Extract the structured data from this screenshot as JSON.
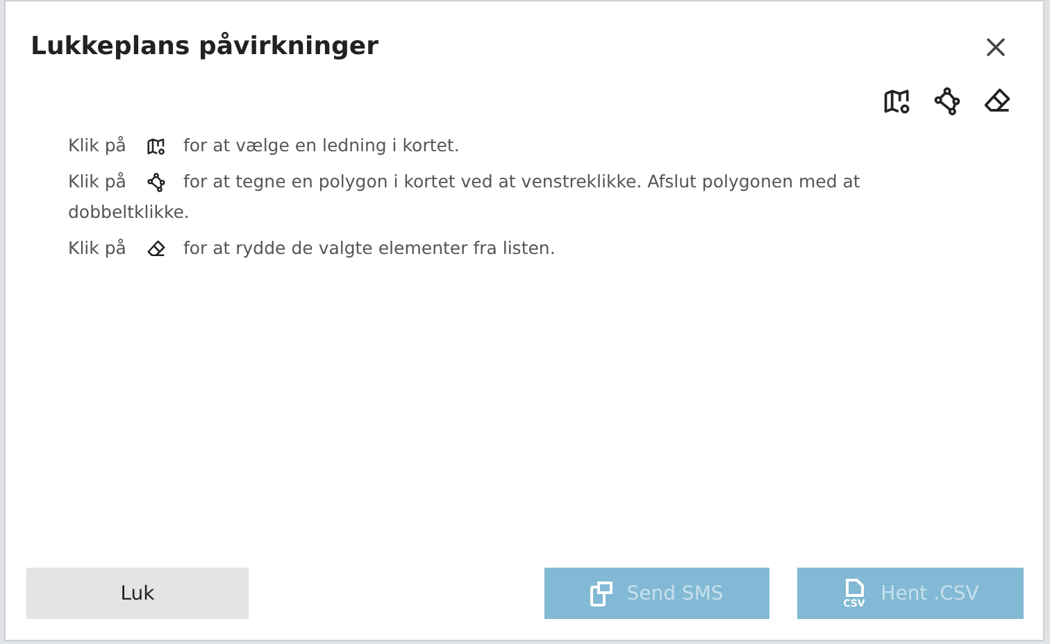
{
  "dialog": {
    "title": "Lukkeplans påvirkninger"
  },
  "tools": [
    {
      "kind": "map"
    },
    {
      "kind": "polygon"
    },
    {
      "kind": "eraser"
    }
  ],
  "instructions": [
    {
      "prefix": "Klik på",
      "kind": "map",
      "text": "for at vælge en ledning i kortet."
    },
    {
      "prefix": "Klik på",
      "kind": "polygon",
      "text": "for at tegne en polygon i kortet ved at venstreklikke. Afslut polygonen med at",
      "continuation": "dobbeltklikke."
    },
    {
      "prefix": "Klik på",
      "kind": "eraser",
      "text": "for at rydde de valgte elementer fra listen."
    }
  ],
  "buttons": [
    {
      "label": "Luk",
      "kind": "close",
      "disabled": false
    },
    {
      "label": "Send SMS",
      "kind": "sms",
      "disabled": true
    },
    {
      "label": "Hent .CSV",
      "kind": "csv",
      "disabled": true,
      "icon_text": "CSV"
    }
  ]
}
